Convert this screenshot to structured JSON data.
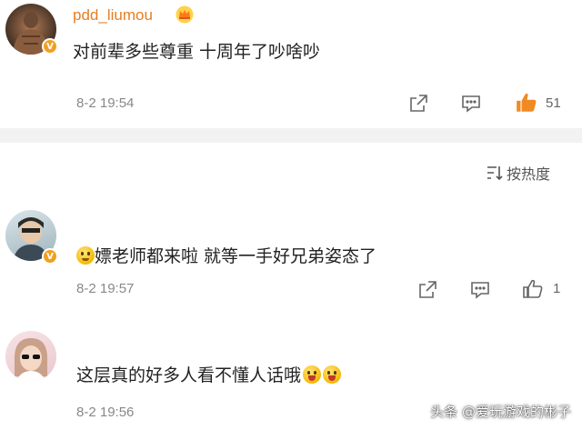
{
  "comments": [
    {
      "username": "pdd_liumou",
      "text": "对前辈多些尊重 十周年了吵啥吵",
      "time": "8-2 19:54",
      "like_count": "51",
      "liked": true,
      "badge_text": "V"
    },
    {
      "username": "",
      "text": "嫖老师都来啦  就等一手好兄弟姿态了",
      "time": "8-2 19:57",
      "like_count": "1",
      "liked": false,
      "badge_text": "V"
    },
    {
      "username": "",
      "text": "这层真的好多人看不懂人话哦",
      "time": "8-2 19:56",
      "like_count": "",
      "liked": false
    }
  ],
  "sort": {
    "label": "按热度"
  },
  "watermark": "头条 @爱玩游戏的彬子",
  "colors": {
    "username": "#e67e22",
    "like_active": "#f08a24",
    "icon_gray": "#666666",
    "divider": "#f2f2f2"
  },
  "icons": [
    "share-icon",
    "comment-icon",
    "like-icon",
    "sort-icon",
    "crown-icon"
  ]
}
